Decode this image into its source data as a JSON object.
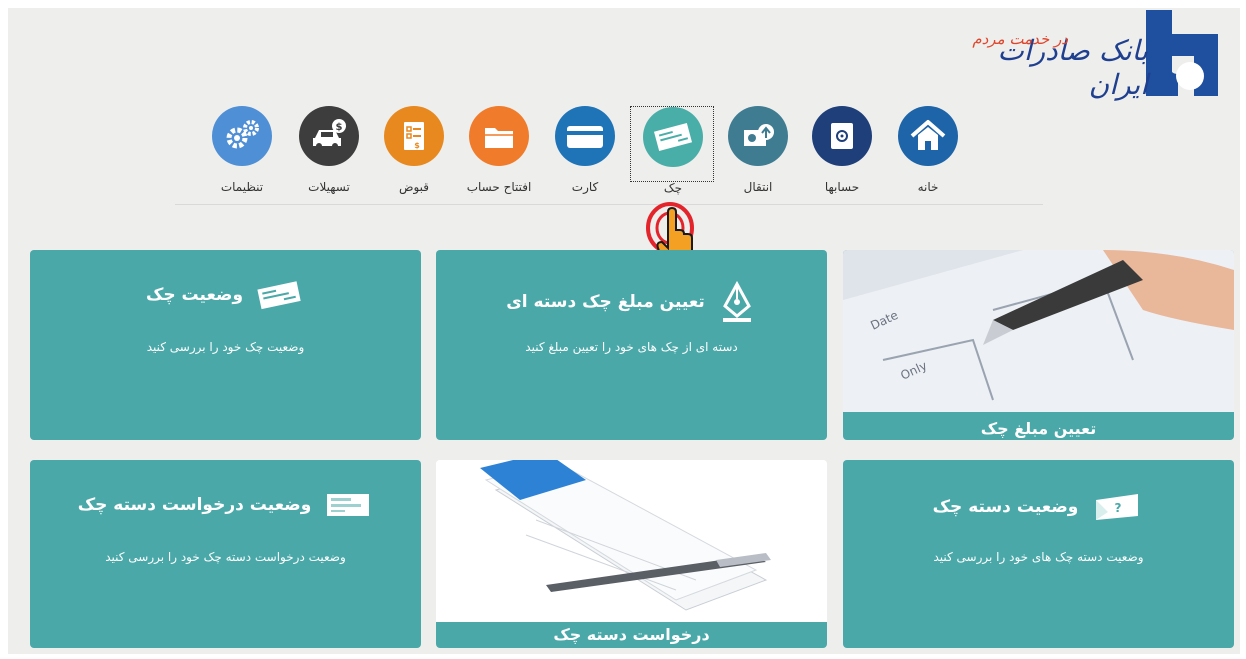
{
  "header": {
    "brand": "بانک صادرات ایران",
    "slogan": "در خدمت مردم"
  },
  "nav": {
    "items": [
      {
        "key": "home",
        "label": "خانه",
        "icon": "home-icon",
        "color": "#1e64a8"
      },
      {
        "key": "accounts",
        "label": "حسابها",
        "icon": "safe-icon",
        "color": "#1e3f7a"
      },
      {
        "key": "transfer",
        "label": "انتقال",
        "icon": "transfer-icon",
        "color": "#3f7c92"
      },
      {
        "key": "cheque",
        "label": "چک",
        "icon": "cheque-icon",
        "color": "#4aaea8",
        "active": true
      },
      {
        "key": "card",
        "label": "کارت",
        "icon": "card-icon",
        "color": "#1f74b8"
      },
      {
        "key": "open-account",
        "label": "افتتاح حساب",
        "icon": "folder-icon",
        "color": "#f07b2b"
      },
      {
        "key": "bills",
        "label": "قبوض",
        "icon": "bill-icon",
        "color": "#e8891f"
      },
      {
        "key": "facilities",
        "label": "تسهیلات",
        "icon": "car-loan-icon",
        "color": "#3d3d3d"
      },
      {
        "key": "settings",
        "label": "تنظیمات",
        "icon": "gears-icon",
        "color": "#4f8fd6"
      }
    ]
  },
  "tiles": {
    "cheque_status": {
      "title": "وضعیت چک",
      "desc": "وضعیت چک خود را بررسی کنید",
      "icon": "cheque-icon"
    },
    "set_batch_amount": {
      "title": "تعیین مبلغ چک دسته ای",
      "desc": "دسته ای از چک های خود را تعیین مبلغ کنید",
      "icon": "pen-nib-icon"
    },
    "set_amount": {
      "caption": "تعیین مبلغ چک",
      "icon": "cheque-photo"
    },
    "book_request_status": {
      "title": "وضعیت درخواست دسته چک",
      "desc": "وضعیت درخواست دسته چک خود را بررسی کنید",
      "icon": "cheque-book-icon"
    },
    "book_request": {
      "caption": "درخواست دسته چک",
      "icon": "cheque-book-photo"
    },
    "book_status": {
      "title": "وضعیت دسته چک",
      "desc": "وضعیت دسته چک های خود را بررسی کنید",
      "icon": "cheque-question-icon"
    }
  }
}
